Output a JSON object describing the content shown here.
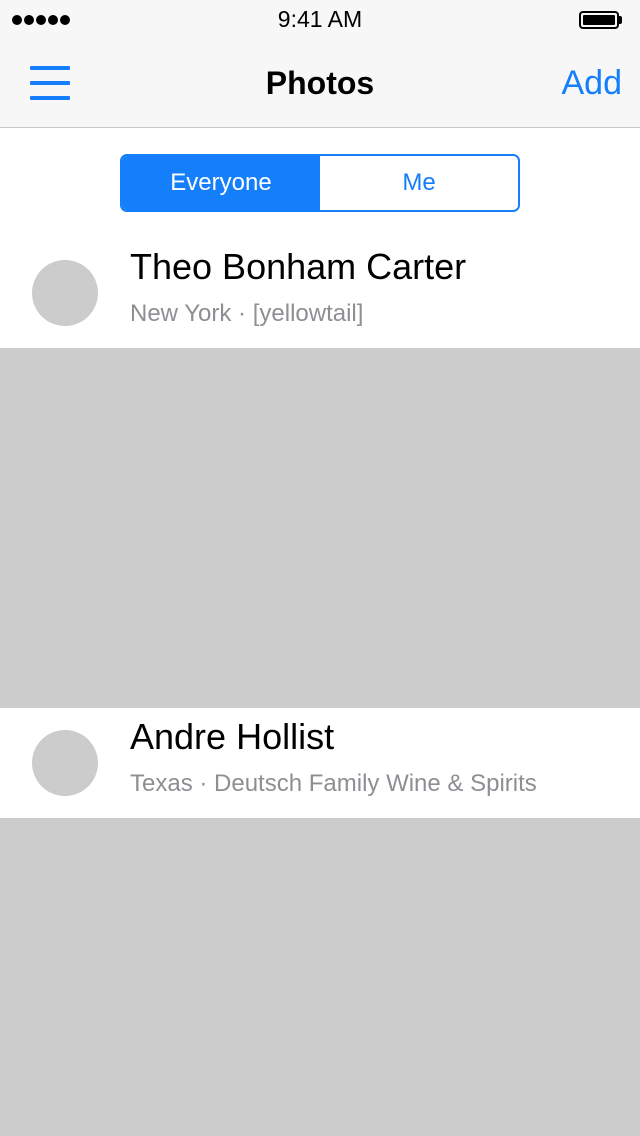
{
  "status_bar": {
    "time": "9:41 AM",
    "signal_icon": "signal-dots-icon",
    "battery_icon": "battery-full-icon"
  },
  "nav": {
    "menu_icon": "hamburger-menu-icon",
    "title": "Photos",
    "add_label": "Add"
  },
  "segments": [
    {
      "label": "Everyone",
      "selected": true
    },
    {
      "label": "Me",
      "selected": false
    }
  ],
  "posts": [
    {
      "name": "Theo Bonham Carter",
      "meta": "New York · [yellowtail]"
    },
    {
      "name": "Andre Hollist",
      "meta": "Texas · Deutsch Family Wine & Spirits"
    }
  ],
  "colors": {
    "accent": "#147efb",
    "placeholder": "#cccccc",
    "secondary_text": "#8e8e93",
    "bar_background": "#f7f7f7"
  }
}
